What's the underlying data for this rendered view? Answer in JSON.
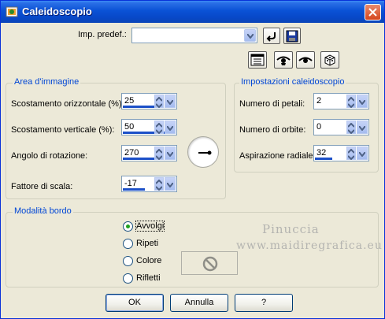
{
  "window": {
    "title": "Caleidoscopio"
  },
  "preset": {
    "label": "Imp. predef.:",
    "value": ""
  },
  "area": {
    "title": "Area d'immagine",
    "fields": [
      {
        "label": "Scostamento orizzontale (%):",
        "value": "25"
      },
      {
        "label": "Scostamento verticale (%):",
        "value": "50"
      },
      {
        "label": "Angolo di rotazione:",
        "value": "270"
      },
      {
        "label": "Fattore di scala:",
        "value": "-17"
      }
    ]
  },
  "settings": {
    "title": "Impostazioni caleidoscopio",
    "fields": [
      {
        "label": "Numero di petali:",
        "value": "2"
      },
      {
        "label": "Numero di orbite:",
        "value": "0"
      },
      {
        "label": "Aspirazione radiale:",
        "value": "32"
      }
    ]
  },
  "border_mode": {
    "title": "Modalità bordo",
    "options": [
      "Avvolgi",
      "Ripeti",
      "Colore",
      "Rifletti"
    ],
    "selected": "Avvolgi"
  },
  "watermark": {
    "line1": "Pinuccia",
    "line2": "www.maidiregrafica.eu"
  },
  "buttons": {
    "ok": "OK",
    "cancel": "Annulla",
    "help": "?"
  },
  "colors": {
    "title_bar": "#0a52d6",
    "group_title": "#0046d5",
    "value_bar": "#1c50c8"
  }
}
